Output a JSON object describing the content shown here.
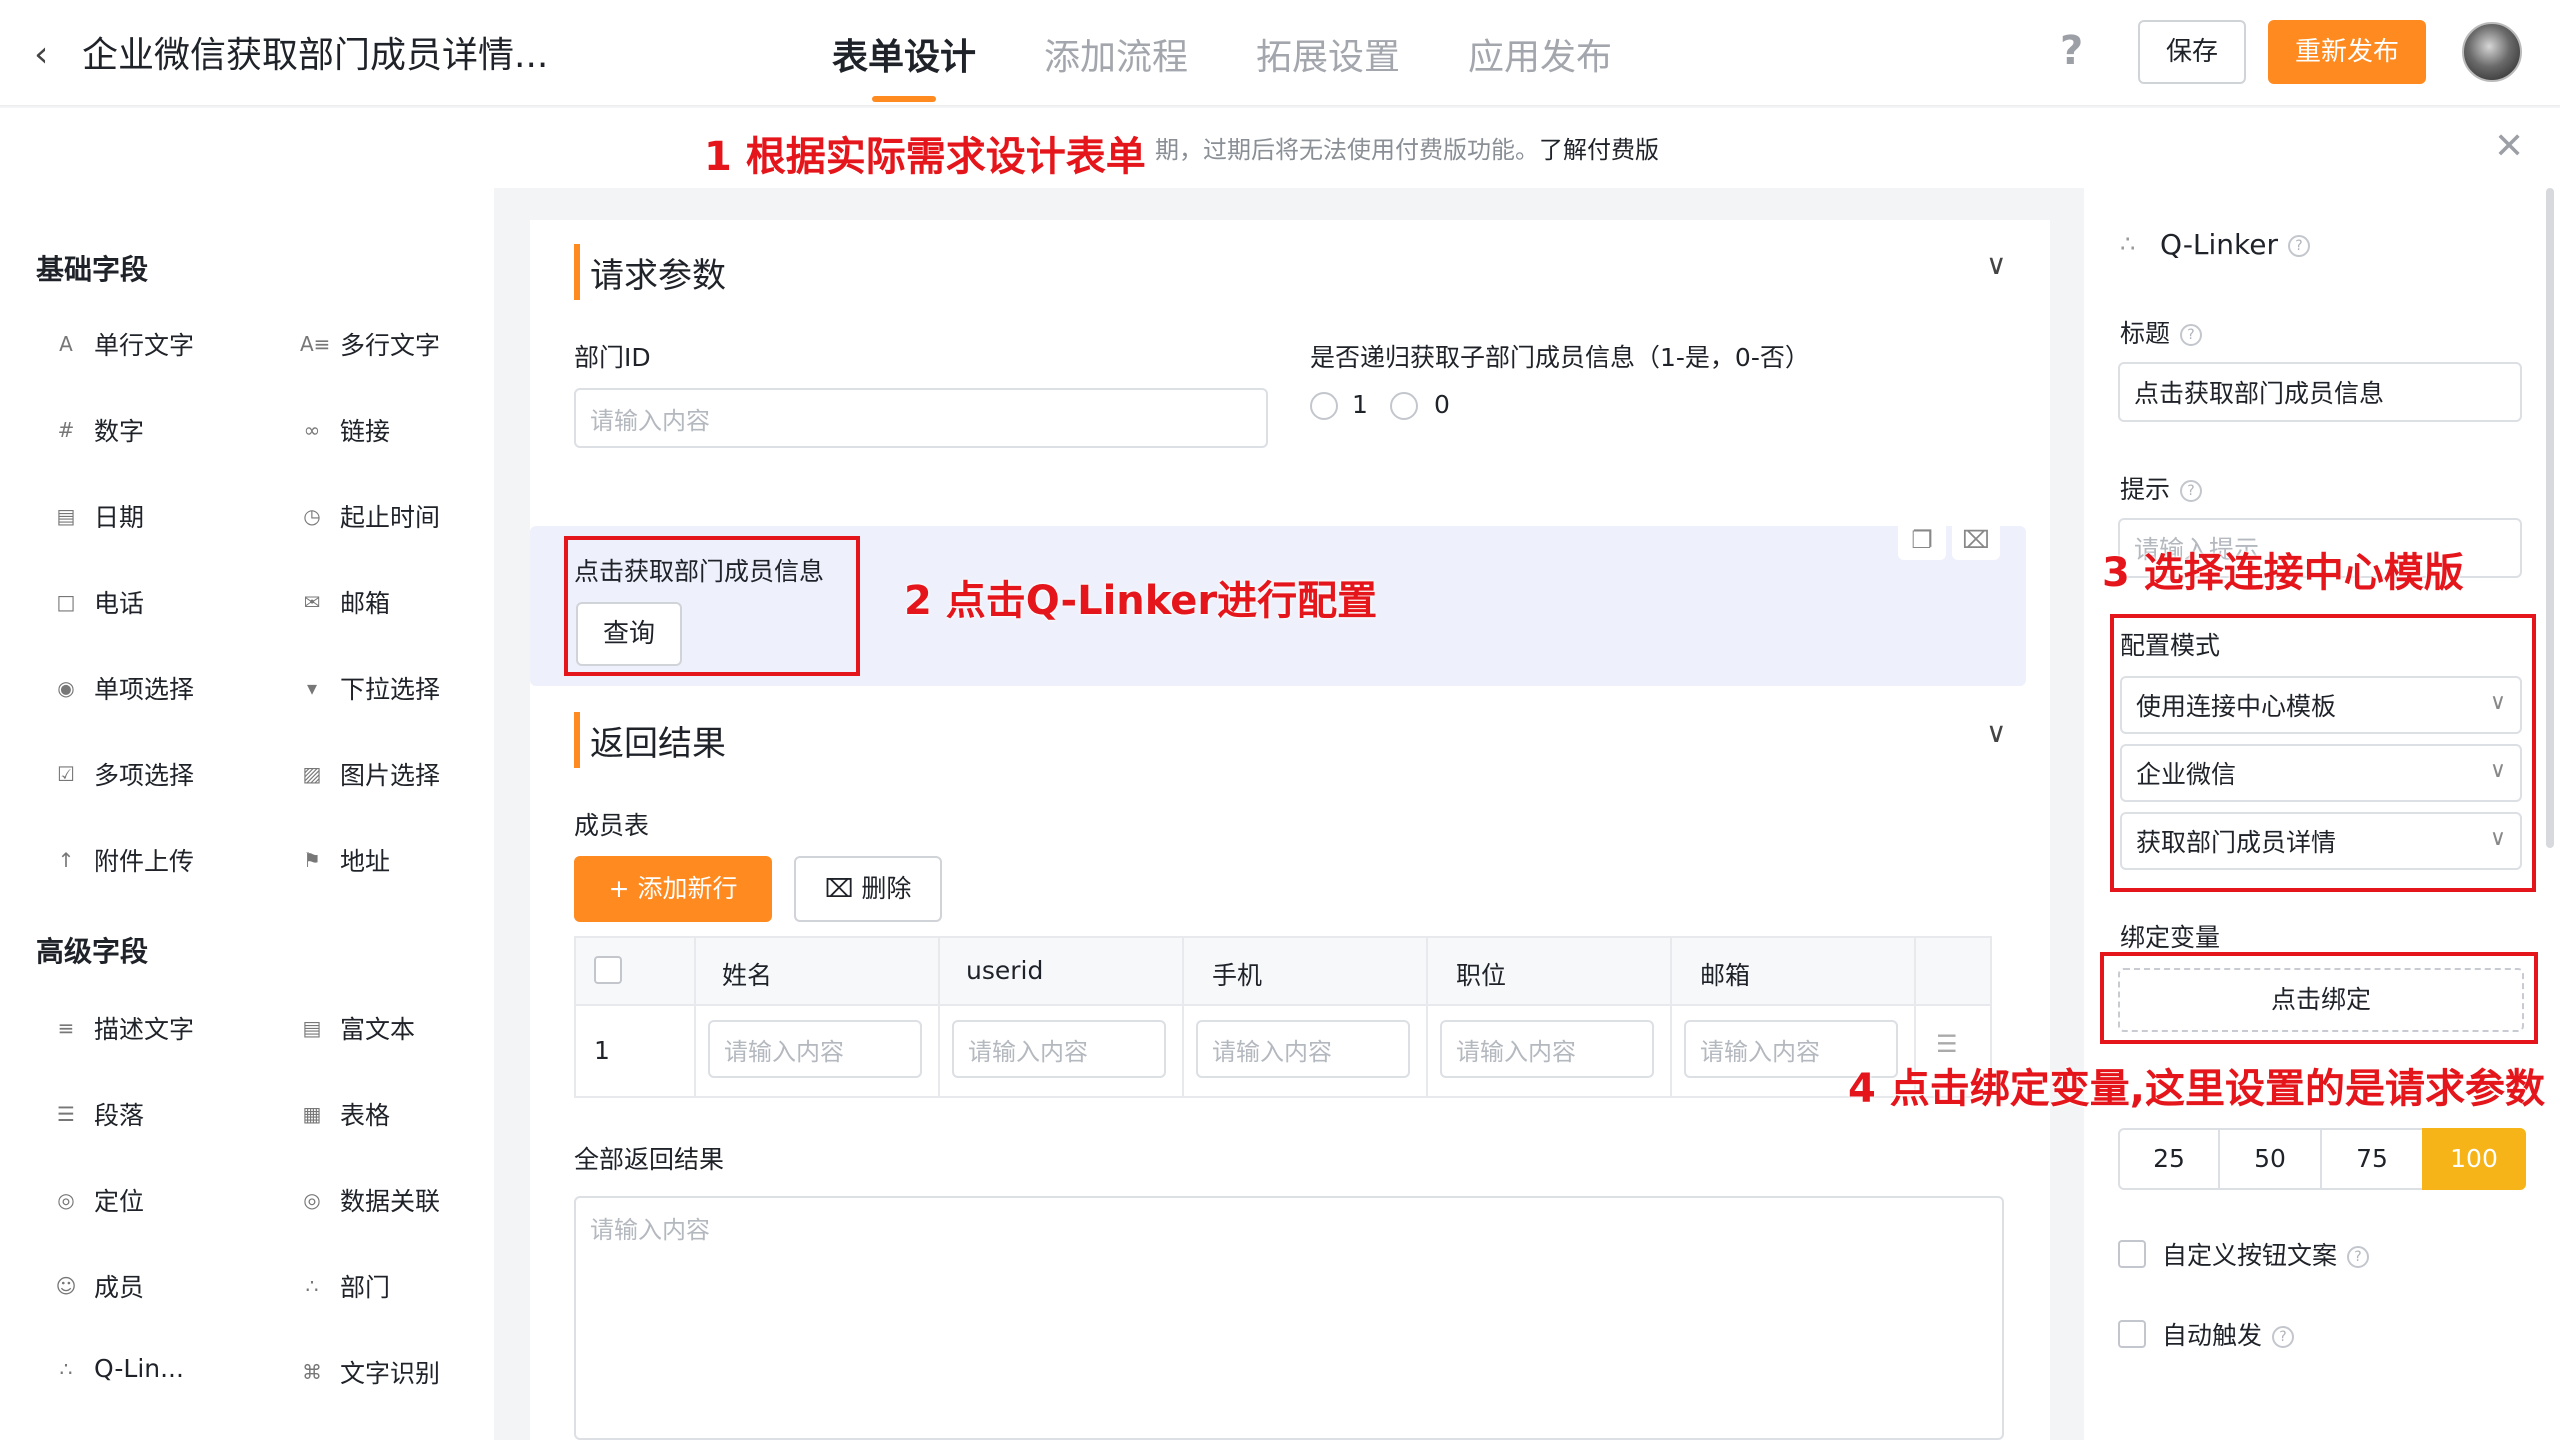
{
  "header": {
    "back_icon": "chevron-left-icon",
    "title": "企业微信获取部门成员详情...",
    "tabs": [
      {
        "label": "表单设计",
        "active": true
      },
      {
        "label": "添加流程",
        "active": false
      },
      {
        "label": "拓展设置",
        "active": false
      },
      {
        "label": "应用发布",
        "active": false
      }
    ],
    "help": "?",
    "save_label": "保存",
    "publish_label": "重新发布"
  },
  "notice": {
    "text": "期，过期后将无法使用付费版功能。",
    "link": "了解付费版"
  },
  "sidebar": {
    "basic_title": "基础字段",
    "basic_fields": [
      "单行文字",
      "多行文字",
      "数字",
      "链接",
      "日期",
      "起止时间",
      "电话",
      "邮箱",
      "单项选择",
      "下拉选择",
      "多项选择",
      "图片选择",
      "附件上传",
      "地址"
    ],
    "advanced_title": "高级字段",
    "advanced_fields": [
      "描述文字",
      "富文本",
      "段落",
      "表格",
      "定位",
      "数据关联",
      "成员",
      "部门",
      "Q-Lin...",
      "文字识别"
    ]
  },
  "canvas": {
    "request_group": "请求参数",
    "dept_id_label": "部门ID",
    "dept_id_placeholder": "请输入内容",
    "recursive_label": "是否递归获取子部门成员信息（1-是，0-否）",
    "radio_options": [
      "1",
      "0"
    ],
    "qlinker_label": "点击获取部门成员信息",
    "query_label": "查询",
    "result_group": "返回结果",
    "member_table_label": "成员表",
    "add_row_label": "添加新行",
    "delete_label": "删除",
    "table_headers": [
      "姓名",
      "userid",
      "手机",
      "职位",
      "邮箱"
    ],
    "row_index": "1",
    "cell_placeholder": "请输入内容",
    "all_results_label": "全部返回结果",
    "all_results_placeholder": "请输入内容"
  },
  "panel": {
    "component_name": "Q-Linker",
    "title_label": "标题",
    "title_value": "点击获取部门成员信息",
    "hint_label": "提示",
    "hint_placeholder": "请输入提示",
    "config_mode_label": "配置模式",
    "config_selects": [
      "使用连接中心模板",
      "企业微信",
      "获取部门成员详情"
    ],
    "bind_var_label": "绑定变量",
    "bind_button": "点击绑定",
    "width_options": [
      "25",
      "50",
      "75",
      "100"
    ],
    "width_selected": "100",
    "custom_btn_text": "自定义按钮文案",
    "auto_trigger": "自动触发"
  },
  "annotations": {
    "step1": "1 根据实际需求设计表单",
    "step2": "2 点击Q-Linker进行配置",
    "step3": "3 选择连接中心模版",
    "step4": "4 点击绑定变量,这里设置的是请求参数"
  },
  "colors": {
    "accent": "#ff8a1f",
    "annotation": "#e5161b",
    "selected_segment": "#f6b418"
  }
}
